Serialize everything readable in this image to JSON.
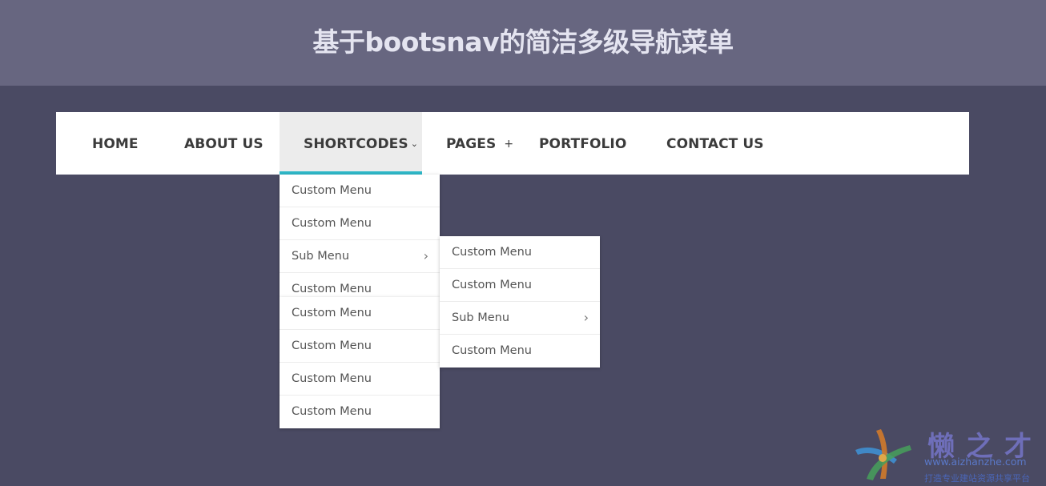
{
  "header": {
    "title": "基于bootsnav的简洁多级导航菜单"
  },
  "nav": {
    "items": [
      {
        "label": "HOME"
      },
      {
        "label": "ABOUT US"
      },
      {
        "label": "SHORTCODES"
      },
      {
        "label": "PAGES"
      },
      {
        "label": "PORTFOLIO"
      },
      {
        "label": "CONTACT US"
      }
    ],
    "active": "SHORTCODES",
    "caret_icon": "chevron-down-icon",
    "plus_glyph": "+"
  },
  "dropdown_level1": {
    "items": [
      "Custom Menu",
      "Custom Menu",
      "Sub Menu",
      "Custom Menu",
      "Custom Menu",
      "Custom Menu",
      "Custom Menu",
      "Custom Menu"
    ]
  },
  "dropdown_level2": {
    "items": [
      "Custom Menu",
      "Custom Menu",
      "Sub Menu",
      "Custom Menu"
    ]
  },
  "watermark": {
    "name": "懒之才",
    "url": "www.aizhanzhe.com",
    "tagline": "打造专业建站资源共享平台"
  },
  "colors": {
    "page_bg": "#4a4a63",
    "header_bg": "#676680",
    "active_underline": "#2fb8c8",
    "nav_text": "#3b3b3b",
    "menu_text": "#555555"
  }
}
